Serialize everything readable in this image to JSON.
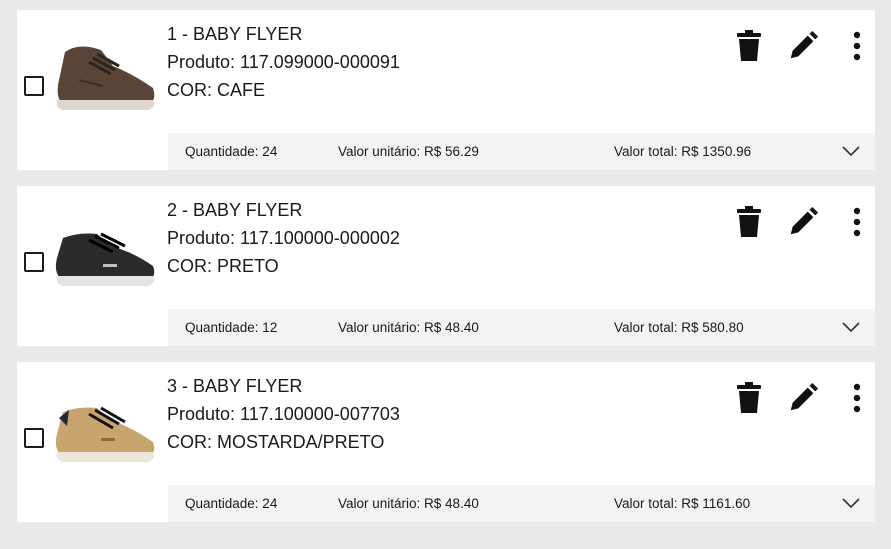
{
  "items": [
    {
      "title": "1 - BABY FLYER",
      "produto": "Produto: 117.099000-000091",
      "cor": "COR: CAFE",
      "quantidade": "Quantidade: 24",
      "valor_unitario": "Valor unitário: R$ 56.29",
      "valor_total": "Valor total: R$ 1350.96",
      "shoe_color": "#5a4438",
      "checked": false
    },
    {
      "title": "2 - BABY FLYER",
      "produto": "Produto: 117.100000-000002",
      "cor": "COR: PRETO",
      "quantidade": "Quantidade: 12",
      "valor_unitario": "Valor unitário: R$ 48.40",
      "valor_total": "Valor total: R$ 580.80",
      "shoe_color": "#2b2b2b",
      "checked": false
    },
    {
      "title": "3 - BABY FLYER",
      "produto": "Produto: 117.100000-007703",
      "cor": "COR: MOSTARDA/PRETO",
      "quantidade": "Quantidade: 24",
      "valor_unitario": "Valor unitário: R$ 48.40",
      "valor_total": "Valor total: R$ 1161.60",
      "shoe_color": "#c8a56c",
      "checked": false
    }
  ],
  "icons": {
    "delete": "trash-icon",
    "edit": "pencil-icon",
    "more": "more-vertical-icon",
    "expand": "chevron-down-icon"
  }
}
